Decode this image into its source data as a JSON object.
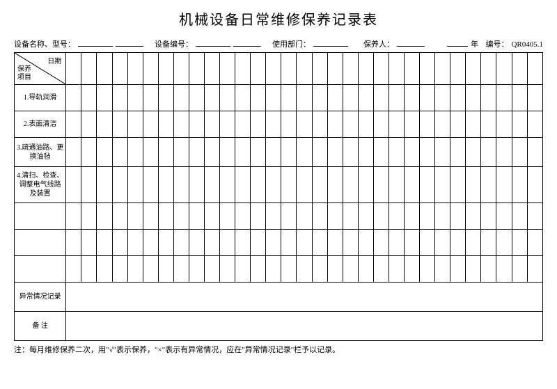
{
  "title": "机械设备日常维修保养记录表",
  "header": {
    "equip_name_label": "设备名称、型号：",
    "equip_no_label": "设备编号：",
    "dept_label": "使用部门：",
    "keeper_label": "保养人：",
    "year_suffix": "年",
    "code_label": "编号：",
    "code_value": "QR0405.1"
  },
  "diagonal": {
    "date_label": "日期",
    "item_label_l1": "保养",
    "item_label_l2": "项目"
  },
  "rows": {
    "r1": "1.导轨润滑",
    "r2": "2.表面清洁",
    "r3_l1": "3.疏通油路、更",
    "r3_l2": "换油毡",
    "r4_l1": "4.清扫、检查、",
    "r4_l2": "调整电气线路",
    "r4_l3": "及装置",
    "r5": "",
    "r6": "",
    "r7": "",
    "r8": "异常情况记录",
    "r9": "备 注"
  },
  "footnote": "注：每月维修保养二次，用\"√\"表示保养，\"×\"表示有异常情况，应在\"异常情况记录\"栏予以记录。"
}
